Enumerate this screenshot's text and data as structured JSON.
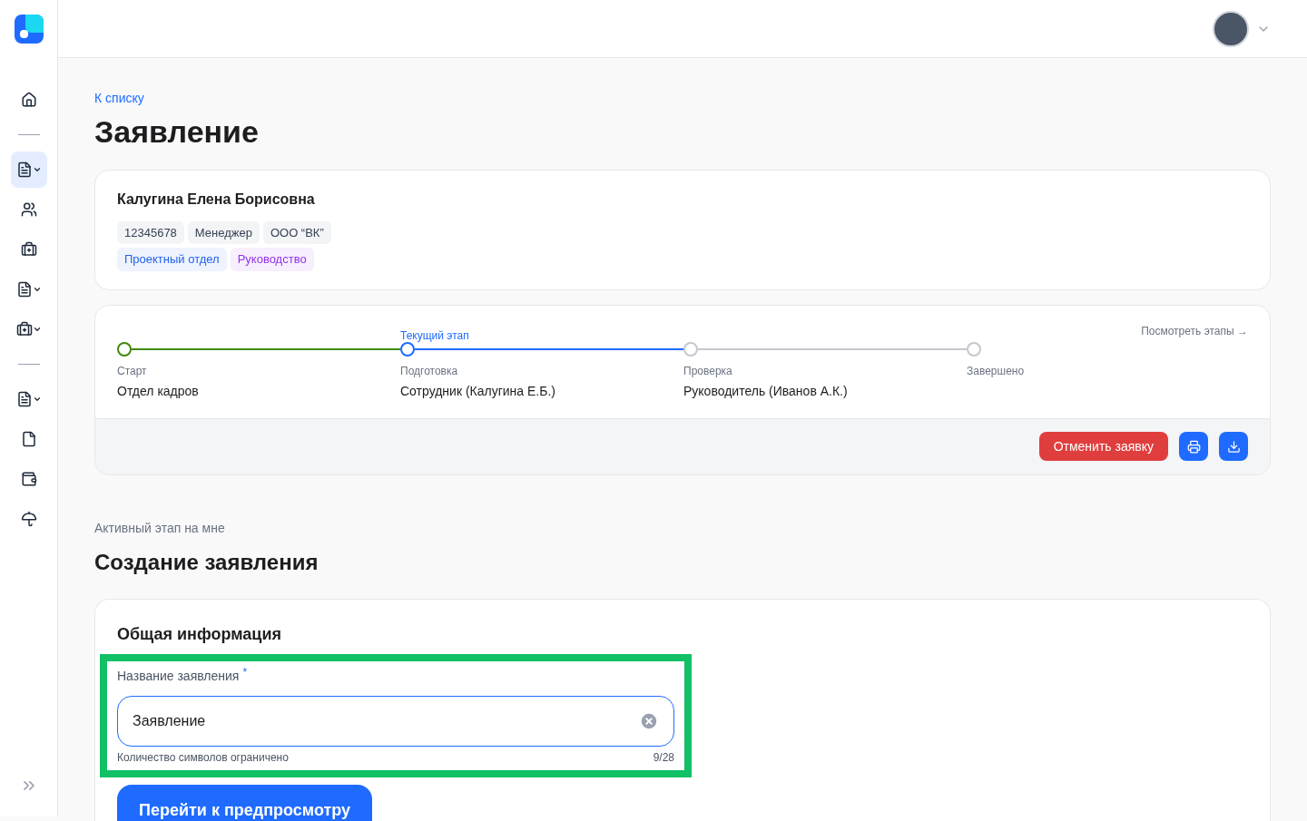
{
  "sidebar": {
    "items": [
      {
        "kind": "home",
        "has_menu": false,
        "selected": false
      },
      {
        "kind": "divider"
      },
      {
        "kind": "list",
        "has_menu": true,
        "selected": true
      },
      {
        "kind": "users",
        "has_menu": false,
        "selected": false
      },
      {
        "kind": "briefcase",
        "has_menu": false,
        "selected": false
      },
      {
        "kind": "list",
        "has_menu": true,
        "selected": false
      },
      {
        "kind": "briefcase",
        "has_menu": true,
        "selected": false
      },
      {
        "kind": "divider"
      },
      {
        "kind": "list",
        "has_menu": true,
        "selected": false
      },
      {
        "kind": "file",
        "has_menu": false,
        "selected": false
      },
      {
        "kind": "wallet",
        "has_menu": false,
        "selected": false
      },
      {
        "kind": "umbrella",
        "has_menu": false,
        "selected": false
      }
    ]
  },
  "back_link": "К списку",
  "title": "Заявление",
  "employee": {
    "name": "Калугина Елена Борисовна",
    "tags": [
      {
        "text": "12345678",
        "color": "#f3f4f6"
      },
      {
        "text": "Менеджер",
        "color": "#f3f4f6"
      },
      {
        "text": "ООО “ВК”",
        "color": "#f3f4f6"
      }
    ],
    "groups": [
      {
        "text": "Проектный отдел",
        "color": "#2563eb"
      },
      {
        "text": "Руководство",
        "color": "#9333ea"
      }
    ]
  },
  "stages": {
    "current_label": "Текущий этап",
    "view_link": "Посмотреть этапы →",
    "items": [
      {
        "name": "Старт",
        "assignee": "Отдел кадров",
        "completed": true,
        "current": false
      },
      {
        "name": "Подготовка",
        "assignee": "Сотрудник (Калугина Е.Б.)",
        "completed": false,
        "current": true
      },
      {
        "name": "Проверка",
        "assignee": "Руководитель (Иванов А.К.)",
        "completed": false,
        "current": false
      },
      {
        "name": "Завершено",
        "completed": false,
        "current": false
      }
    ]
  },
  "actions": {
    "cancel": "Отменить заявку"
  },
  "active_caption": "Активный этап на мне",
  "section_title": "Создание заявления",
  "form": {
    "title": "Общая информация",
    "highlighted": true,
    "field": {
      "label": "Название заявления",
      "required_mark": "*",
      "value": "Заявление",
      "hint": "Количество символов ограничено",
      "counter": "9/28"
    },
    "submit": "Перейти к предпросмотру"
  }
}
